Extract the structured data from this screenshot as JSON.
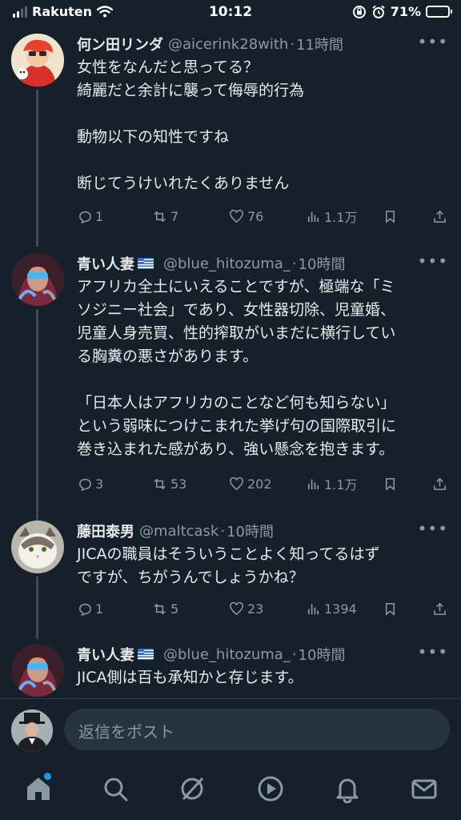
{
  "status_bar": {
    "carrier": "Rakuten",
    "time": "10:12",
    "battery_percent": "71%",
    "battery_level": 0.71
  },
  "tweets": [
    {
      "name": "何ン田リンダ",
      "handle": "@aicerink28with",
      "time": "11時間",
      "lines": [
        "女性をなんだと思ってる？",
        "綺麗だと余計に襲って侮辱的行為",
        "",
        "動物以下の知性ですね",
        "",
        "断じてうけいれたくありません"
      ],
      "replies": "1",
      "reposts": "7",
      "likes": "76",
      "views": "1.1万"
    },
    {
      "name": "青い人妻",
      "handle": "@blue_hitozuma_",
      "time": "10時間",
      "lines": [
        "アフリカ全土にいえることですが、極端な「ミ",
        "ソジニー社会」であり、女性器切除、児童婚、",
        "児童人身売買、性的搾取がいまだに横行してい",
        "る胸糞の悪さがあります。",
        "",
        "「日本人はアフリカのことなど何も知らない」",
        "という弱味につけこまれた挙げ句の国際取引に",
        "巻き込まれた感があり、強い懸念を抱きます。"
      ],
      "replies": "3",
      "reposts": "53",
      "likes": "202",
      "views": "1.1万"
    },
    {
      "name": "藤田泰男",
      "handle": "@maltcask",
      "time": "10時間",
      "lines": [
        "JICAの職員はそういうことよく知ってるはず",
        "ですが、ちがうんでしょうかね？"
      ],
      "replies": "1",
      "reposts": "5",
      "likes": "23",
      "views": "1394"
    },
    {
      "name": "青い人妻",
      "handle": "@blue_hitozuma_",
      "time": "10時間",
      "lines": [
        "JICA側は百も承知かと存じます。"
      ]
    }
  ],
  "composer": {
    "placeholder": "返信をポスト"
  },
  "tabbar": [
    {
      "icon": "home-icon",
      "active": true
    },
    {
      "icon": "search-icon"
    },
    {
      "icon": "grok-icon"
    },
    {
      "icon": "video-icon"
    },
    {
      "icon": "bell-icon"
    },
    {
      "icon": "mail-icon"
    }
  ],
  "colors": {
    "background": "#15202b",
    "accent": "#1d9bf0",
    "muted": "#8b98a5",
    "text": "#e7e9ea"
  }
}
